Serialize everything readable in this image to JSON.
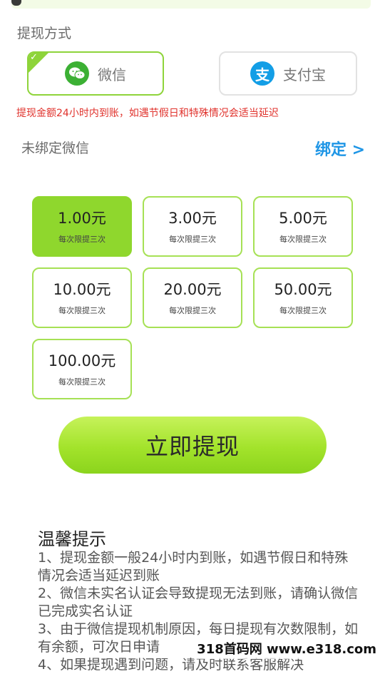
{
  "method": {
    "title": "提现方式",
    "options": [
      {
        "label": "微信",
        "icon": "wechat-icon",
        "selected": true
      },
      {
        "label": "支付宝",
        "icon": "alipay-icon",
        "icon_glyph": "支",
        "selected": false
      }
    ]
  },
  "notice": "提现金额24小时内到账，如遇节假日和特殊情况会适当延迟",
  "binding": {
    "status": "未绑定微信",
    "action": "绑定 >"
  },
  "amounts": [
    {
      "value": "1.00元",
      "limit": "每次限提三次",
      "selected": true
    },
    {
      "value": "3.00元",
      "limit": "每次限提三次",
      "selected": false
    },
    {
      "value": "5.00元",
      "limit": "每次限提三次",
      "selected": false
    },
    {
      "value": "10.00元",
      "limit": "每次限提三次",
      "selected": false
    },
    {
      "value": "20.00元",
      "limit": "每次限提三次",
      "selected": false
    },
    {
      "value": "50.00元",
      "limit": "每次限提三次",
      "selected": false
    },
    {
      "value": "100.00元",
      "limit": "每次限提三次",
      "selected": false
    }
  ],
  "withdraw_button": "立即提现",
  "tips": {
    "title": "温馨提示",
    "items": [
      "1、提现金额一般24小时内到账，如遇节假日和特殊情况会适当延迟到账",
      "2、微信未实名认证会导致提现无法到账，请确认微信已完成实名认证",
      "3、由于微信提现机制原因，每日提现有次数限制，如有余额，可次日申请",
      "4、如果提现遇到问题，请及时联系客服解决"
    ]
  },
  "watermark": "318首码网 www.e318.com",
  "colors": {
    "accent": "#8fd72d",
    "notice": "#e0322c",
    "link": "#1f96e6"
  }
}
